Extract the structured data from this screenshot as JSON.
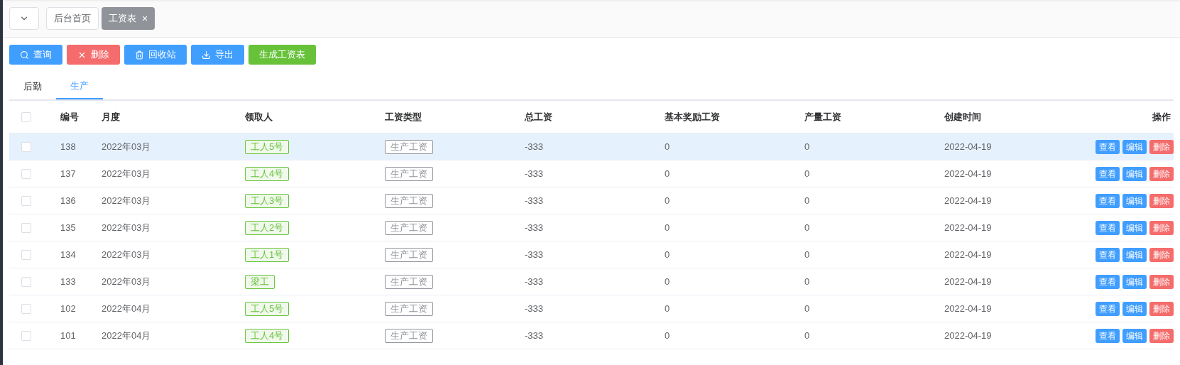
{
  "page_tabs": [
    {
      "label": "后台首页",
      "selected": false
    },
    {
      "label": "工资表",
      "selected": true,
      "close": "×"
    }
  ],
  "toolbar": [
    {
      "label": "查询",
      "kind": "search",
      "color": "#409eff"
    },
    {
      "label": "删除",
      "kind": "delete",
      "color": "#f56c6c"
    },
    {
      "label": "回收站",
      "kind": "trash",
      "color": "#409eff"
    },
    {
      "label": "导出",
      "kind": "export",
      "color": "#409eff"
    },
    {
      "label": "生成工资表",
      "kind": "plain",
      "color": "#67c23a"
    }
  ],
  "tabs": [
    {
      "label": "后勤",
      "selected": false
    },
    {
      "label": "生产",
      "selected": true
    }
  ],
  "table": {
    "select_all_checked": false,
    "columns": [
      "编号",
      "月度",
      "领取人",
      "工资类型",
      "总工资",
      "基本奖励工资",
      "产量工资",
      "创建时间",
      "操作"
    ],
    "rows": [
      {
        "checked": false,
        "highlighted": true,
        "cells": [
          "138",
          "2022年03月",
          "工人5号",
          "生产工资",
          "-333",
          "0",
          "0",
          "2022-04-19"
        ],
        "actions": [
          {
            "label": "查看",
            "color": "#409eff"
          },
          {
            "label": "编辑",
            "color": "#409eff"
          },
          {
            "label": "删除",
            "color": "#f56c6c"
          }
        ]
      },
      {
        "checked": false,
        "highlighted": false,
        "cells": [
          "137",
          "2022年03月",
          "工人4号",
          "生产工资",
          "-333",
          "0",
          "0",
          "2022-04-19"
        ],
        "actions": [
          {
            "label": "查看",
            "color": "#409eff"
          },
          {
            "label": "编辑",
            "color": "#409eff"
          },
          {
            "label": "删除",
            "color": "#f56c6c"
          }
        ]
      },
      {
        "checked": false,
        "highlighted": false,
        "cells": [
          "136",
          "2022年03月",
          "工人3号",
          "生产工资",
          "-333",
          "0",
          "0",
          "2022-04-19"
        ],
        "actions": [
          {
            "label": "查看",
            "color": "#409eff"
          },
          {
            "label": "编辑",
            "color": "#409eff"
          },
          {
            "label": "删除",
            "color": "#f56c6c"
          }
        ]
      },
      {
        "checked": false,
        "highlighted": false,
        "cells": [
          "135",
          "2022年03月",
          "工人2号",
          "生产工资",
          "-333",
          "0",
          "0",
          "2022-04-19"
        ],
        "actions": [
          {
            "label": "查看",
            "color": "#409eff"
          },
          {
            "label": "编辑",
            "color": "#409eff"
          },
          {
            "label": "删除",
            "color": "#f56c6c"
          }
        ]
      },
      {
        "checked": false,
        "highlighted": false,
        "cells": [
          "134",
          "2022年03月",
          "工人1号",
          "生产工资",
          "-333",
          "0",
          "0",
          "2022-04-19"
        ],
        "actions": [
          {
            "label": "查看",
            "color": "#409eff"
          },
          {
            "label": "编辑",
            "color": "#409eff"
          },
          {
            "label": "删除",
            "color": "#f56c6c"
          }
        ]
      },
      {
        "checked": false,
        "highlighted": false,
        "cells": [
          "133",
          "2022年03月",
          "梁工",
          "生产工资",
          "-333",
          "0",
          "0",
          "2022-04-19"
        ],
        "actions": [
          {
            "label": "查看",
            "color": "#409eff"
          },
          {
            "label": "编辑",
            "color": "#409eff"
          },
          {
            "label": "删除",
            "color": "#f56c6c"
          }
        ]
      },
      {
        "checked": false,
        "highlighted": false,
        "cells": [
          "102",
          "2022年04月",
          "工人5号",
          "生产工资",
          "-333",
          "0",
          "0",
          "2022-04-19"
        ],
        "actions": [
          {
            "label": "查看",
            "color": "#409eff"
          },
          {
            "label": "编辑",
            "color": "#409eff"
          },
          {
            "label": "删除",
            "color": "#f56c6c"
          }
        ]
      },
      {
        "checked": false,
        "highlighted": false,
        "cells": [
          "101",
          "2022年04月",
          "工人4号",
          "生产工资",
          "-333",
          "0",
          "0",
          "2022-04-19"
        ],
        "actions": [
          {
            "label": "查看",
            "color": "#409eff"
          },
          {
            "label": "编辑",
            "color": "#409eff"
          },
          {
            "label": "删除",
            "color": "#f56c6c"
          }
        ]
      }
    ]
  }
}
